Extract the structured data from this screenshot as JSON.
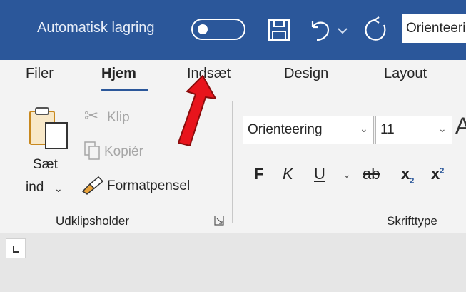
{
  "titlebar": {
    "autosave_label": "Automatisk lagring",
    "document_name": "Orienteering"
  },
  "tabs": [
    {
      "label": "Filer"
    },
    {
      "label": "Hjem"
    },
    {
      "label": "Indsæt"
    },
    {
      "label": "Design"
    },
    {
      "label": "Layout"
    }
  ],
  "clipboard": {
    "paste_line1": "Sæt",
    "paste_line2": "ind",
    "cut": "Klip",
    "copy": "Kopiér",
    "format_painter": "Formatpensel",
    "group_label": "Udklipsholder"
  },
  "font": {
    "font_name": "Orienteering",
    "font_size": "11",
    "bold": "F",
    "italic": "K",
    "underline": "U",
    "strikethrough": "ab",
    "subscript": "x",
    "superscript": "x",
    "grow_partial": "A",
    "group_label": "Skrifttype"
  },
  "colors": {
    "titlebar": "#2b579a",
    "ribbon": "#f3f3f3",
    "arrow": "#e8141c"
  }
}
